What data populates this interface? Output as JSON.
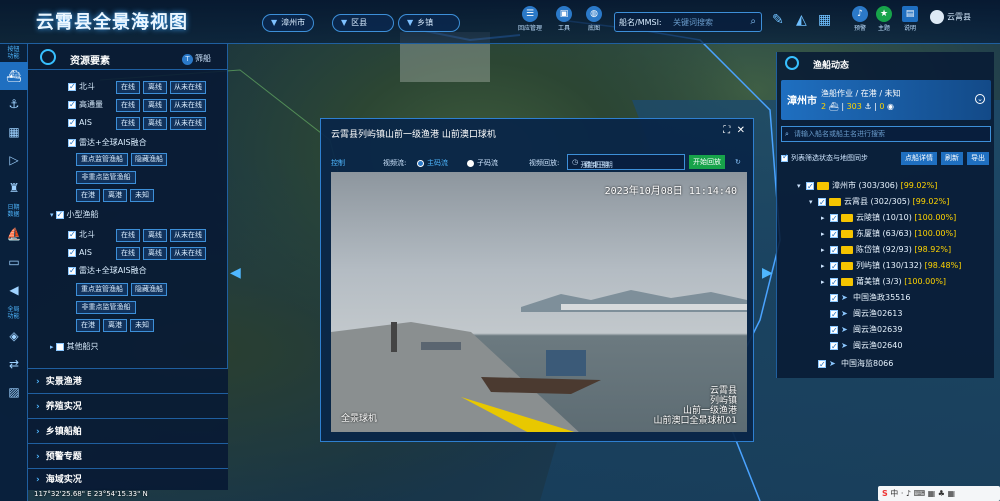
{
  "header": {
    "title": "云霄县全景海视图",
    "selects": [
      "漳州市",
      "区县",
      "乡镇"
    ],
    "icons": [
      "回应管理",
      "工具",
      "底图"
    ],
    "search_label": "船名/MMSI:",
    "search_placeholder": "关键词搜索",
    "right_icons": [
      "预警",
      "主题",
      "说明"
    ],
    "user": "云霄县"
  },
  "left_nav": {
    "sec1": "按钮\n功能",
    "sec2": "日期\n数据",
    "sec3": "全局\n功能"
  },
  "resource": {
    "title": "资源要素",
    "filter": "筛船",
    "rows": [
      {
        "label": "北斗",
        "btns": [
          "在线",
          "离线",
          "从未在线"
        ]
      },
      {
        "label": "高通量",
        "btns": [
          "在线",
          "离线",
          "从未在线"
        ]
      },
      {
        "label": "AIS",
        "btns": [
          "在线",
          "离线",
          "从未在线"
        ]
      },
      {
        "label": "雷达+全球AIS融合",
        "btns": []
      },
      {
        "label": "",
        "btns": [
          "重点监管渔船",
          "隐藏渔船"
        ]
      },
      {
        "label": "",
        "btns": [
          "非重点监管渔船"
        ]
      },
      {
        "label": "",
        "btns": [
          "在港",
          "离港",
          "未知"
        ]
      },
      {
        "label": "小型渔船",
        "btns": []
      },
      {
        "label": "北斗",
        "btns": [
          "在线",
          "离线",
          "从未在线"
        ]
      },
      {
        "label": "AIS",
        "btns": [
          "在线",
          "离线",
          "从未在线"
        ]
      },
      {
        "label": "雷达+全球AIS融合",
        "btns": []
      },
      {
        "label": "",
        "btns": [
          "重点监管渔船",
          "隐藏渔船"
        ]
      },
      {
        "label": "",
        "btns": [
          "非重点监管渔船"
        ]
      },
      {
        "label": "",
        "btns": [
          "在港",
          "离港",
          "未知"
        ]
      },
      {
        "label": "其他船只",
        "btns": []
      }
    ]
  },
  "left_sections": [
    "实景渔港",
    "养殖实况",
    "乡镇船舶",
    "预警专题",
    "海域实况"
  ],
  "video": {
    "title": "云霄县列屿镇山前一级渔港 山前澳口球机",
    "ctrl": "控制",
    "stream_label": "视频流:",
    "main_stream": "主码流",
    "sub_stream": "子码流",
    "replay_label": "视频回放:",
    "start_date": "开始日期",
    "to": "至",
    "end_date": "结束日期",
    "play": "开始回放",
    "timestamp": "2023年10月08日 11:14:40",
    "left_caption": "全景球机",
    "right_caption": [
      "云霄县",
      "列屿镇",
      "山前一级渔港",
      "山前澳口全景球机01"
    ]
  },
  "right": {
    "title": "渔船动态",
    "city": "漳州市",
    "line1": "渔船作业 / 在港 / 未知",
    "line2_a": "2",
    "line2_b": "303",
    "line2_c": "0",
    "search_placeholder": "请输入船名或船主名进行搜索",
    "sync": "列表筛选状态与地图同步",
    "btn1": "点船详情",
    "btn2": "刷新",
    "btn3": "导出",
    "tree": [
      {
        "text": "漳州市 (303/306)",
        "pct": "[99.02%]",
        "level": 0,
        "type": "folder",
        "open": true
      },
      {
        "text": "云霄县 (302/305)",
        "pct": "[99.02%]",
        "level": 1,
        "type": "folder",
        "open": true
      },
      {
        "text": "云陵镇 (10/10)",
        "pct": "[100.00%]",
        "level": 2,
        "type": "folder"
      },
      {
        "text": "东厦镇 (63/63)",
        "pct": "[100.00%]",
        "level": 2,
        "type": "folder"
      },
      {
        "text": "陈岱镇 (92/93)",
        "pct": "[98.92%]",
        "level": 2,
        "type": "folder"
      },
      {
        "text": "列屿镇 (130/132)",
        "pct": "[98.48%]",
        "level": 2,
        "type": "folder"
      },
      {
        "text": "莆美镇 (3/3)",
        "pct": "[100.00%]",
        "level": 2,
        "type": "folder"
      },
      {
        "text": "中国渔政35516",
        "pct": "",
        "level": 2,
        "type": "boat"
      },
      {
        "text": "闽云渔02613",
        "pct": "",
        "level": 2,
        "type": "boat"
      },
      {
        "text": "闽云渔02639",
        "pct": "",
        "level": 2,
        "type": "boat"
      },
      {
        "text": "闽云渔02640",
        "pct": "",
        "level": 2,
        "type": "boat"
      },
      {
        "text": "中国海监8066",
        "pct": "",
        "level": 1,
        "type": "boat"
      }
    ]
  },
  "coord": "117°32'25.68\" E   23°54'15.33\" N",
  "colors": {
    "accent": "#1f6fc0",
    "highlight": "#ffd400",
    "panel": "#081a34"
  }
}
